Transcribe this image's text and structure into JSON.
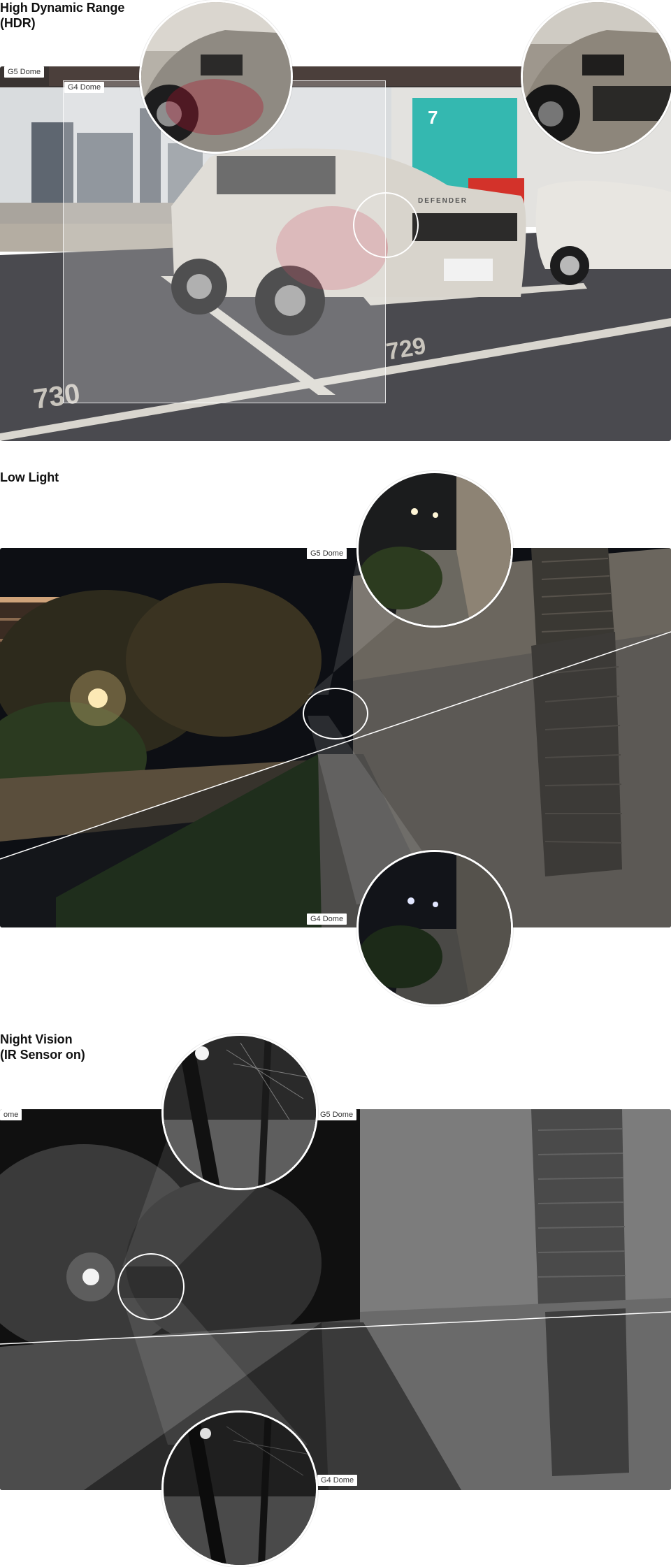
{
  "sections": [
    {
      "id": "hdr",
      "title": "High Dynamic Range\n(HDR)",
      "label_g5": "G5 Dome",
      "label_g4": "G4 Dome"
    },
    {
      "id": "lowlight",
      "title": "Low Light",
      "label_g5": "G5 Dome",
      "label_g4": "G4 Dome"
    },
    {
      "id": "night",
      "title": "Night Vision\n(IR Sensor on)",
      "label_g5": "G5 Dome",
      "label_g4": "G4 Dome",
      "label_partial": "ome"
    }
  ],
  "scene_text": {
    "pole_number": "7",
    "floor_marking_left": "730",
    "floor_marking_right": "729",
    "car_brand": "DEFENDER"
  },
  "colors": {
    "parking_pillar": "#34b8b0",
    "parking_floor": "#4a4a4f",
    "night_sky": "#0d0f14",
    "wall": "#6b665e"
  }
}
